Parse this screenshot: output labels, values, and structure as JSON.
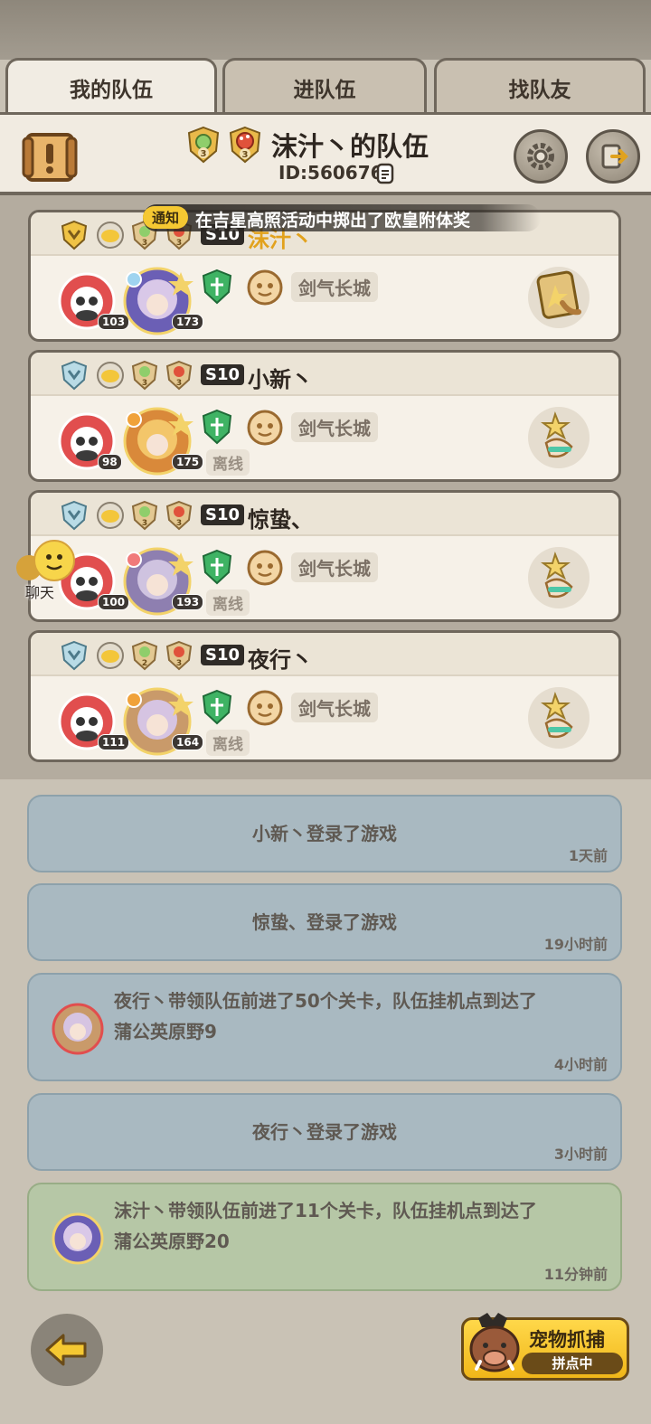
{
  "tabs": [
    {
      "label": "我的队伍",
      "active": true
    },
    {
      "label": "进队伍",
      "active": false
    },
    {
      "label": "找队友",
      "active": false
    }
  ],
  "header": {
    "badge_level_1": "3",
    "badge_level_2": "3",
    "title": "沫汁丶的队伍",
    "team_id": "ID:560676"
  },
  "notice": {
    "tag": "通知",
    "text": "在吉星高照活动中掷出了欧皇附体奖"
  },
  "members": [
    {
      "season": "S10",
      "name": "沫汁丶",
      "panda_level": "103",
      "char_level": "173",
      "location": "剑气长城",
      "status": "",
      "badge_a": "3",
      "badge_b": "3",
      "name_color": "#e2a21d"
    },
    {
      "season": "S10",
      "name": "小新丶",
      "panda_level": "98",
      "char_level": "175",
      "location": "剑气长城",
      "status": "离线",
      "badge_a": "3",
      "badge_b": "3",
      "name_color": "#2e2620"
    },
    {
      "season": "S10",
      "name": "惊蛰、",
      "panda_level": "100",
      "char_level": "193",
      "location": "剑气长城",
      "status": "离线",
      "badge_a": "3",
      "badge_b": "3",
      "name_color": "#2e2620"
    },
    {
      "season": "S10",
      "name": "夜行丶",
      "panda_level": "111",
      "char_level": "164",
      "location": "剑气长城",
      "status": "离线",
      "badge_a": "2",
      "badge_b": "3",
      "name_color": "#2e2620"
    }
  ],
  "chat_label": "聊天",
  "logs": [
    {
      "line1": "小新丶登录了游戏",
      "line2": "",
      "time": "1天前",
      "has_avatar": false,
      "theme": "blue"
    },
    {
      "line1": "惊蛰、登录了游戏",
      "line2": "",
      "time": "19小时前",
      "has_avatar": false,
      "theme": "blue"
    },
    {
      "line1": "夜行丶带领队伍前进了50个关卡，队伍挂机点到达了",
      "line2": "蒲公英原野9",
      "time": "4小时前",
      "has_avatar": true,
      "theme": "blue"
    },
    {
      "line1": "夜行丶登录了游戏",
      "line2": "",
      "time": "3小时前",
      "has_avatar": false,
      "theme": "blue"
    },
    {
      "line1": "沫汁丶带领队伍前进了11个关卡，队伍挂机点到达了",
      "line2": "蒲公英原野20",
      "time": "11分钟前",
      "has_avatar": true,
      "theme": "green"
    }
  ],
  "pet_catch": {
    "title": "宠物抓捕",
    "sub": "拼点中"
  },
  "colors": {
    "accent_gold": "#f5c832",
    "log_blue": "#a9b9c1",
    "log_green": "#b6c7a6",
    "panel_border": "#6f675c"
  }
}
